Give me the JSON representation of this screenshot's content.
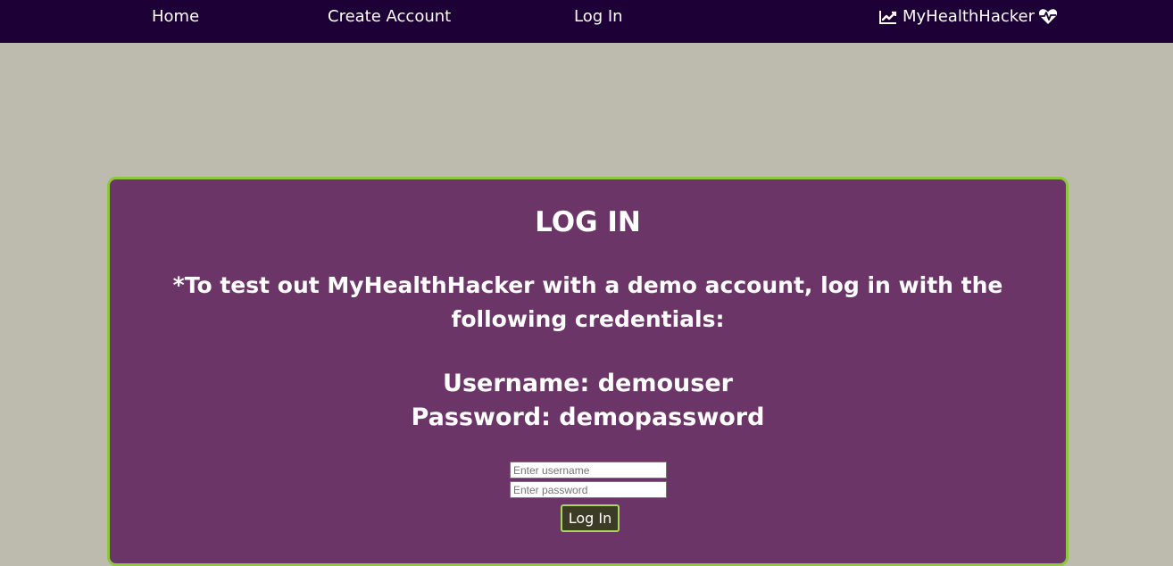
{
  "nav": {
    "home": "Home",
    "create_account": "Create Account",
    "log_in": "Log In",
    "brand": "MyHealthHacker",
    "brand_left_icon": "line-chart-icon",
    "brand_right_icon": "heartbeat-icon"
  },
  "login": {
    "title": "LOG IN",
    "demo_note": "*To test out MyHealthHacker with a demo account, log in with the following credentials:",
    "username_line": "Username: demouser",
    "password_line": "Password: demopassword",
    "username_placeholder": "Enter username",
    "password_placeholder": "Enter password",
    "username_value": "",
    "password_value": "",
    "submit_label": "Log In"
  },
  "colors": {
    "navbar_bg": "#1c0036",
    "page_bg": "#bcbbae",
    "card_bg": "#6c3567",
    "card_border": "#8dc63f",
    "button_border": "#a6d95a"
  }
}
